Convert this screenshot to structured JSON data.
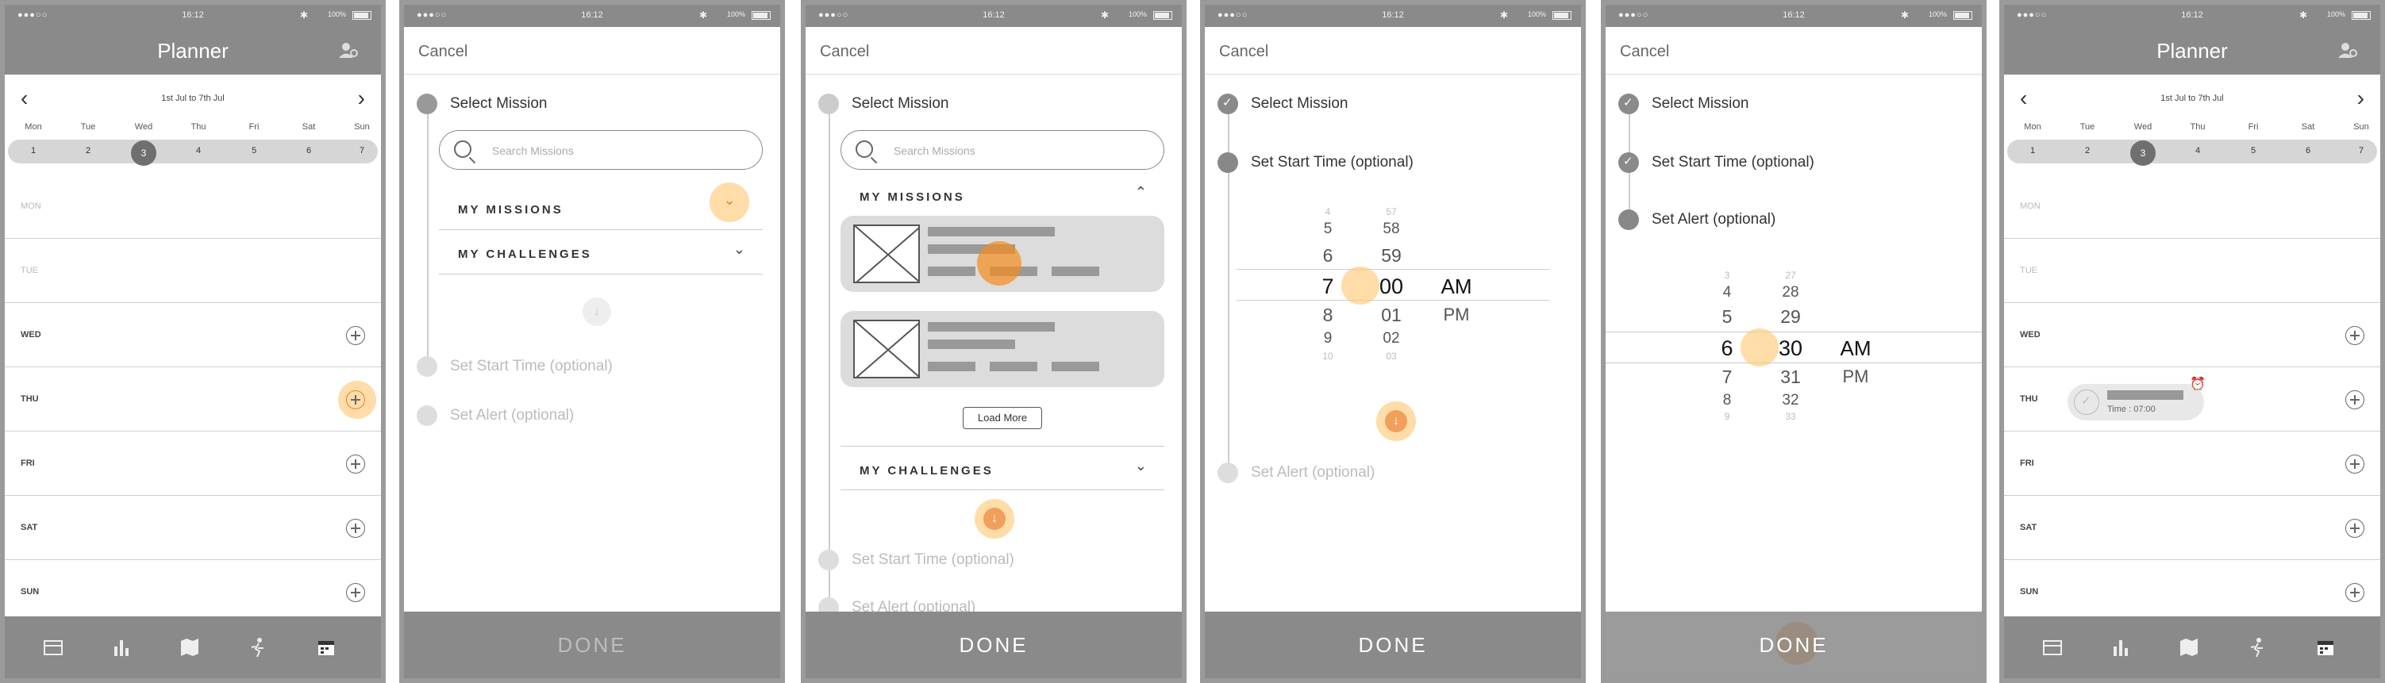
{
  "status": {
    "signal": "●●●○○",
    "time": "16:12",
    "battery": "100%",
    "bluetooth": "✱"
  },
  "planner": {
    "title": "Planner",
    "range": "1st Jul to 7th Jul",
    "prev": "‹",
    "next": "›",
    "day_names": [
      "Mon",
      "Tue",
      "Wed",
      "Thu",
      "Fri",
      "Sat",
      "Sun"
    ],
    "day_numbers": [
      "1",
      "2",
      "3",
      "4",
      "5",
      "6",
      "7"
    ],
    "selected_day": "3",
    "rows": [
      "MON",
      "TUE",
      "WED",
      "THU",
      "FRI",
      "SAT",
      "SUN"
    ],
    "reminder_time": "Time : 07:00"
  },
  "nav_icons": [
    "calendar-grid-icon",
    "bar-chart-icon",
    "map-icon",
    "running-icon",
    "calendar-icon"
  ],
  "wizard": {
    "cancel": "Cancel",
    "step1": "Select Mission",
    "step2": "Set Start Time (optional)",
    "step3": "Set Alert (optional)",
    "search_placeholder": "Search Missions",
    "my_missions": "MY MISSIONS",
    "my_challenges": "MY CHALLENGES",
    "load_more": "Load More",
    "done": "DONE"
  },
  "picker1": {
    "hours": [
      "4",
      "5",
      "6",
      "7",
      "8",
      "9",
      "10"
    ],
    "minutes": [
      "57",
      "58",
      "59",
      "00",
      "01",
      "02",
      "03"
    ],
    "ampm": [
      "AM",
      "PM"
    ]
  },
  "picker2": {
    "hours": [
      "3",
      "4",
      "5",
      "6",
      "7",
      "8",
      "9"
    ],
    "minutes": [
      "27",
      "28",
      "29",
      "30",
      "31",
      "32",
      "33"
    ],
    "ampm": [
      "AM",
      "PM"
    ]
  }
}
